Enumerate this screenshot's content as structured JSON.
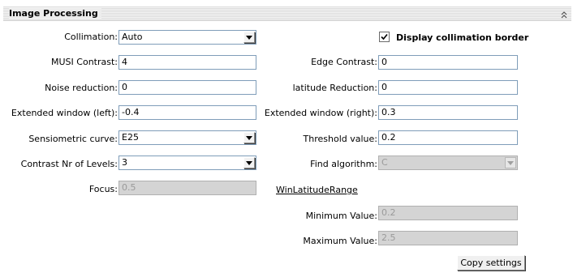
{
  "panel": {
    "title": "Image Processing",
    "collapse_icon": "double-chevron-up-icon"
  },
  "left": {
    "collimation": {
      "label": "Collimation:",
      "value": "Auto"
    },
    "musi_contrast": {
      "label": "MUSI Contrast:",
      "value": "4"
    },
    "noise_reduction": {
      "label": "Noise reduction:",
      "value": "0"
    },
    "extended_window_left": {
      "label": "Extended window (left):",
      "value": "-0.4"
    },
    "sensiometric_curve": {
      "label": "Sensiometric curve:",
      "value": "E25"
    },
    "contrast_levels": {
      "label": "Contrast Nr of Levels:",
      "value": "3"
    },
    "focus": {
      "label": "Focus:",
      "value": "0.5"
    }
  },
  "right": {
    "display_collimation_border": {
      "label": "Display collimation border",
      "checked": true
    },
    "edge_contrast": {
      "label": "Edge Contrast:",
      "value": "0"
    },
    "latitude_reduction": {
      "label": "latitude Reduction:",
      "value": "0"
    },
    "extended_window_right": {
      "label": "Extended window (right):",
      "value": "0.3"
    },
    "threshold_value": {
      "label": "Threshold value:",
      "value": "0.2"
    },
    "find_algorithm": {
      "label": "Find algorithm:",
      "value": "C"
    },
    "win_latitude_range": {
      "link_label": "WinLatitudeRange",
      "minimum": {
        "label": "Minimum Value:",
        "value": "0.2"
      },
      "maximum": {
        "label": "Maximum Value:",
        "value": "2.5"
      }
    }
  },
  "buttons": {
    "copy_settings": "Copy settings"
  }
}
